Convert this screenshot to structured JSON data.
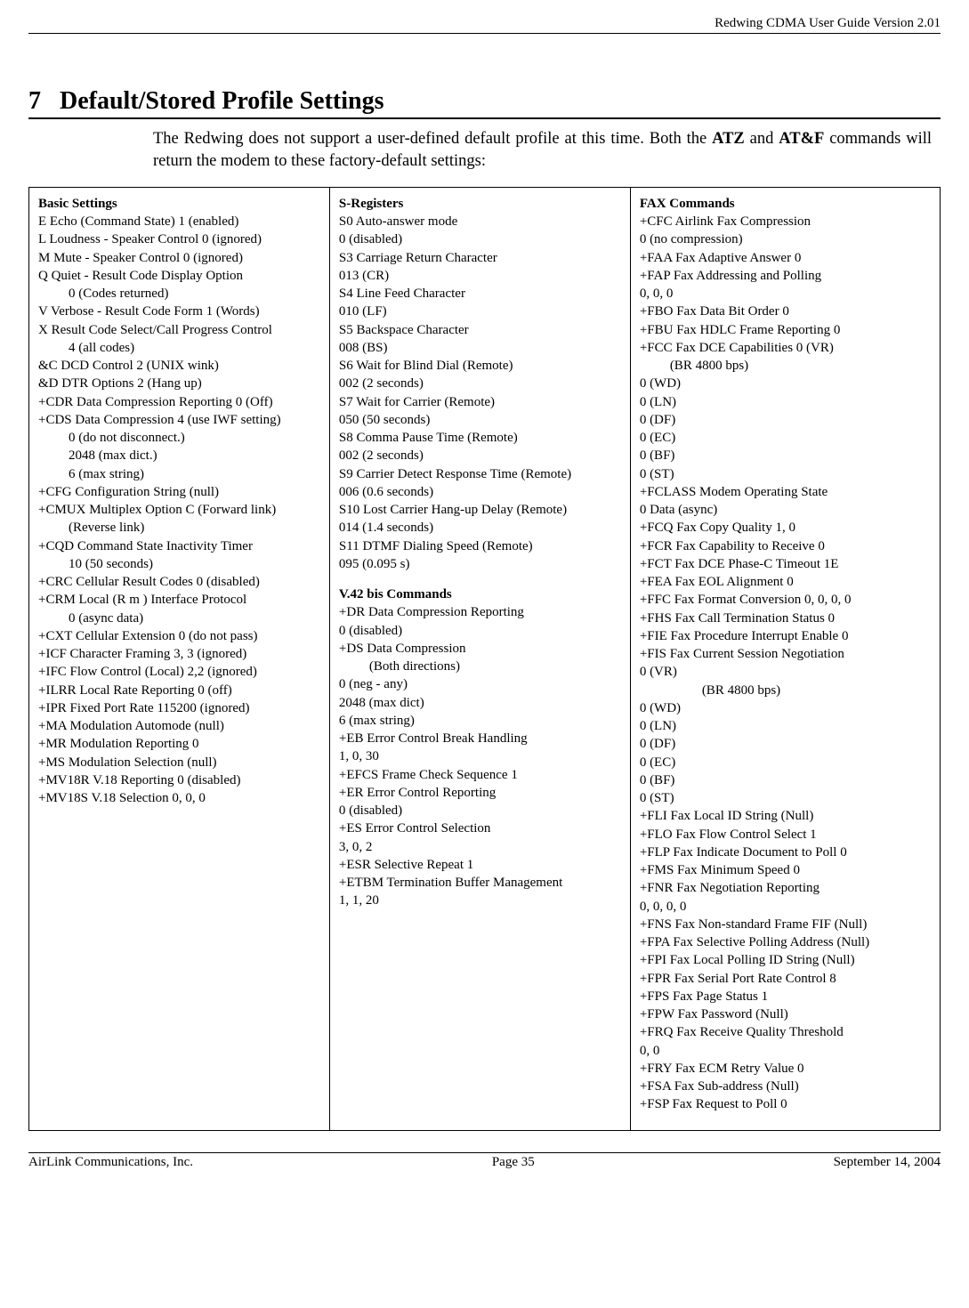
{
  "header": {
    "right": "Redwing CDMA User Guide Version 2.01"
  },
  "section": {
    "number": "7",
    "title": "Default/Stored Profile Settings"
  },
  "intro": {
    "prefix": "The Redwing does not support a user-defined default profile at this time. Both the ",
    "atz": "ATZ",
    "mid": "  and ",
    "atf": "AT&F",
    "suffix": " commands will return the modem to these factory-default settings:"
  },
  "col1": {
    "head": "Basic Settings",
    "lines": [
      "E Echo (Command State) 1 (enabled)",
      "L Loudness - Speaker Control 0 (ignored)",
      "M Mute - Speaker Control 0 (ignored)",
      "Q Quiet - Result Code Display Option",
      {
        "indent": "0 (Codes returned)"
      },
      "V Verbose - Result Code Form 1 (Words)",
      "X Result Code Select/Call Progress Control",
      {
        "indent": "4 (all codes)"
      },
      "&C DCD Control 2 (UNIX wink)",
      "&D DTR Options 2 (Hang up)",
      "+CDR Data Compression Reporting 0 (Off)",
      "+CDS Data Compression 4 (use IWF setting)",
      {
        "indent": "0 (do not disconnect.)"
      },
      {
        "indent": "2048 (max dict.)"
      },
      {
        "indent": "6 (max string)"
      },
      "+CFG Configuration String (null)",
      "+CMUX Multiplex Option C (Forward link)",
      {
        "indent": "(Reverse link)"
      },
      "+CQD Command State Inactivity Timer",
      {
        "indent": "10 (50 seconds)"
      },
      "+CRC Cellular Result Codes 0 (disabled)",
      "+CRM Local (R m ) Interface Protocol",
      {
        "indent": "0 (async data)"
      },
      "+CXT Cellular Extension 0 (do not pass)",
      "+ICF Character Framing 3, 3 (ignored)",
      "+IFC Flow Control (Local) 2,2 (ignored)",
      "+ILRR Local Rate Reporting 0 (off)",
      "+IPR Fixed Port Rate 115200 (ignored)",
      "+MA Modulation Automode (null)",
      "+MR Modulation Reporting 0",
      "+MS Modulation Selection (null)",
      "+MV18R V.18 Reporting 0 (disabled)",
      "+MV18S V.18 Selection 0, 0, 0"
    ]
  },
  "col2": {
    "head1": "S-Registers",
    "lines1": [
      "S0 Auto-answer mode",
      "0 (disabled)",
      "S3 Carriage Return Character",
      "013 (CR)",
      "S4 Line Feed Character",
      "010 (LF)",
      "S5 Backspace Character",
      "008 (BS)",
      "S6 Wait for Blind Dial (Remote)",
      "002 (2 seconds)",
      "S7 Wait for Carrier (Remote)",
      "050 (50 seconds)",
      "S8 Comma Pause Time (Remote)",
      "002 (2 seconds)",
      "S9 Carrier Detect Response Time (Remote)",
      "006 (0.6 seconds)",
      "S10 Lost Carrier Hang-up Delay (Remote)",
      "014 (1.4 seconds)",
      "S11 DTMF Dialing Speed (Remote)",
      "095 (0.095 s)"
    ],
    "head2": "V.42 bis Commands",
    "lines2": [
      "+DR Data Compression Reporting",
      "0 (disabled)",
      "+DS Data Compression",
      {
        "indent": "(Both directions)"
      },
      "0 (neg - any)",
      "2048 (max dict)",
      "6 (max string)",
      "+EB Error Control Break Handling",
      "1, 0, 30",
      "+EFCS Frame Check Sequence 1",
      "+ER Error Control Reporting",
      "0 (disabled)",
      "+ES Error Control Selection",
      "3, 0, 2",
      "+ESR Selective Repeat 1",
      "+ETBM Termination Buffer Management",
      "1, 1, 20"
    ]
  },
  "col3": {
    "head": "FAX Commands",
    "lines": [
      "+CFC Airlink Fax Compression",
      "0 (no compression)",
      "+FAA Fax Adaptive Answer 0",
      "+FAP Fax Addressing and Polling",
      "0, 0, 0",
      "+FBO Fax Data Bit Order 0",
      "+FBU Fax HDLC Frame Reporting 0",
      "+FCC Fax DCE Capabilities 0 (VR)",
      {
        "indent": "(BR 4800 bps)"
      },
      "0 (WD)",
      "0 (LN)",
      "0 (DF)",
      "0 (EC)",
      "0 (BF)",
      "0 (ST)",
      "+FCLASS Modem Operating State",
      "0 Data (async)",
      "+FCQ Fax Copy Quality 1, 0",
      "+FCR Fax Capability to Receive 0",
      "+FCT Fax DCE Phase-C Timeout 1E",
      "+FEA Fax EOL Alignment 0",
      "+FFC Fax Format Conversion 0, 0, 0, 0",
      "+FHS Fax Call Termination Status 0",
      "+FIE Fax Procedure Interrupt Enable 0",
      "+FIS Fax Current Session Negotiation",
      "0 (VR)",
      {
        "indent2": "(BR 4800 bps)"
      },
      "0 (WD)",
      "0 (LN)",
      "0 (DF)",
      "0 (EC)",
      "0 (BF)",
      "0 (ST)",
      "+FLI Fax Local ID String (Null)",
      "+FLO Fax Flow Control Select 1",
      "+FLP Fax Indicate Document to Poll 0",
      "+FMS Fax Minimum Speed 0",
      "+FNR Fax Negotiation Reporting",
      "0, 0, 0, 0",
      "+FNS Fax Non-standard Frame FIF (Null)",
      "+FPA Fax Selective Polling Address (Null)",
      "+FPI Fax Local Polling ID String (Null)",
      "+FPR Fax Serial Port Rate Control 8",
      "+FPS Fax Page Status 1",
      "+FPW Fax Password (Null)",
      "+FRQ Fax Receive Quality Threshold",
      "0, 0",
      "+FRY Fax ECM Retry Value 0",
      "+FSA Fax Sub-address (Null)",
      "+FSP Fax Request to Poll 0"
    ]
  },
  "footer": {
    "left": "AirLink Communications, Inc.",
    "center": "Page 35",
    "right": "September 14, 2004"
  }
}
